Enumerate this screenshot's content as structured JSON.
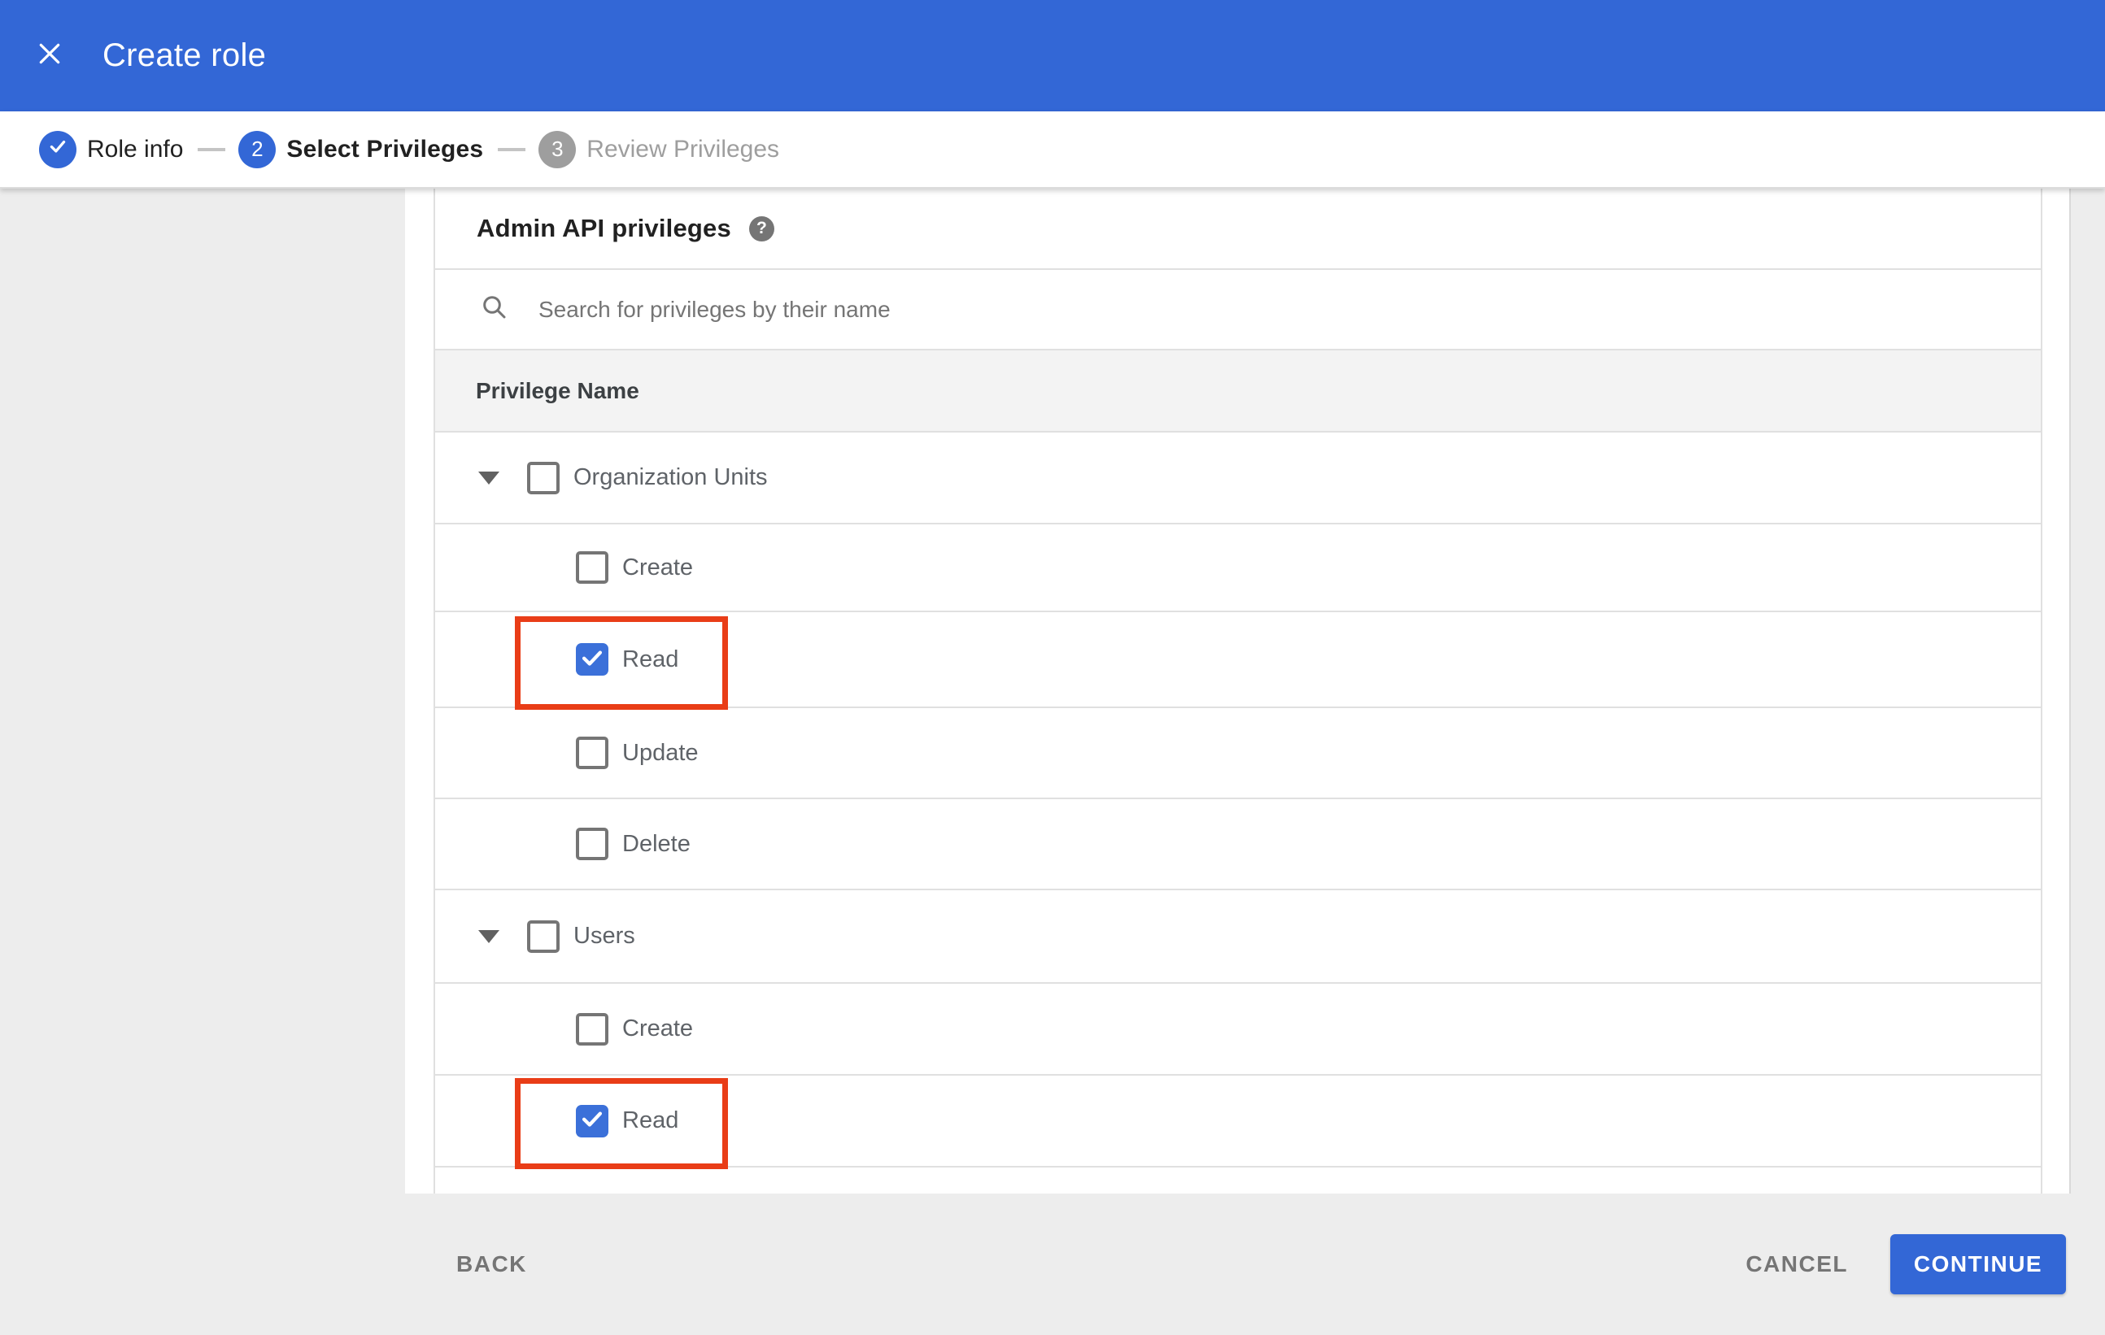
{
  "header": {
    "title": "Create role"
  },
  "stepper": {
    "steps": [
      {
        "number": "1",
        "label": "Role info",
        "state": "completed"
      },
      {
        "number": "2",
        "label": "Select Privileges",
        "state": "active"
      },
      {
        "number": "3",
        "label": "Review Privileges",
        "state": "upcoming"
      }
    ]
  },
  "panel": {
    "heading": "Admin API privileges",
    "search_placeholder": "Search for privileges by their name",
    "column_header": "Privilege Name"
  },
  "privileges": {
    "groups": [
      {
        "label": "Organization Units",
        "checked": false,
        "expanded": true,
        "children": [
          {
            "label": "Create",
            "checked": false,
            "highlighted": false
          },
          {
            "label": "Read",
            "checked": true,
            "highlighted": true
          },
          {
            "label": "Update",
            "checked": false,
            "highlighted": false
          },
          {
            "label": "Delete",
            "checked": false,
            "highlighted": false
          }
        ]
      },
      {
        "label": "Users",
        "checked": false,
        "expanded": true,
        "children": [
          {
            "label": "Create",
            "checked": false,
            "highlighted": false
          },
          {
            "label": "Read",
            "checked": true,
            "highlighted": true
          }
        ]
      }
    ]
  },
  "footer": {
    "back_label": "BACK",
    "cancel_label": "CANCEL",
    "continue_label": "CONTINUE"
  },
  "colors": {
    "appbar_blue": "#3367d6",
    "checkbox_blue": "#3b70d9",
    "highlight_red": "#e93d17",
    "panel_gray": "#ededed",
    "table_header_gray": "#f3f3f3",
    "border_gray": "#e0e0e0",
    "text_dark": "#212121",
    "text_gray": "#5f6368",
    "muted_gray": "#757575",
    "inactive_step_gray": "#9e9e9e"
  }
}
